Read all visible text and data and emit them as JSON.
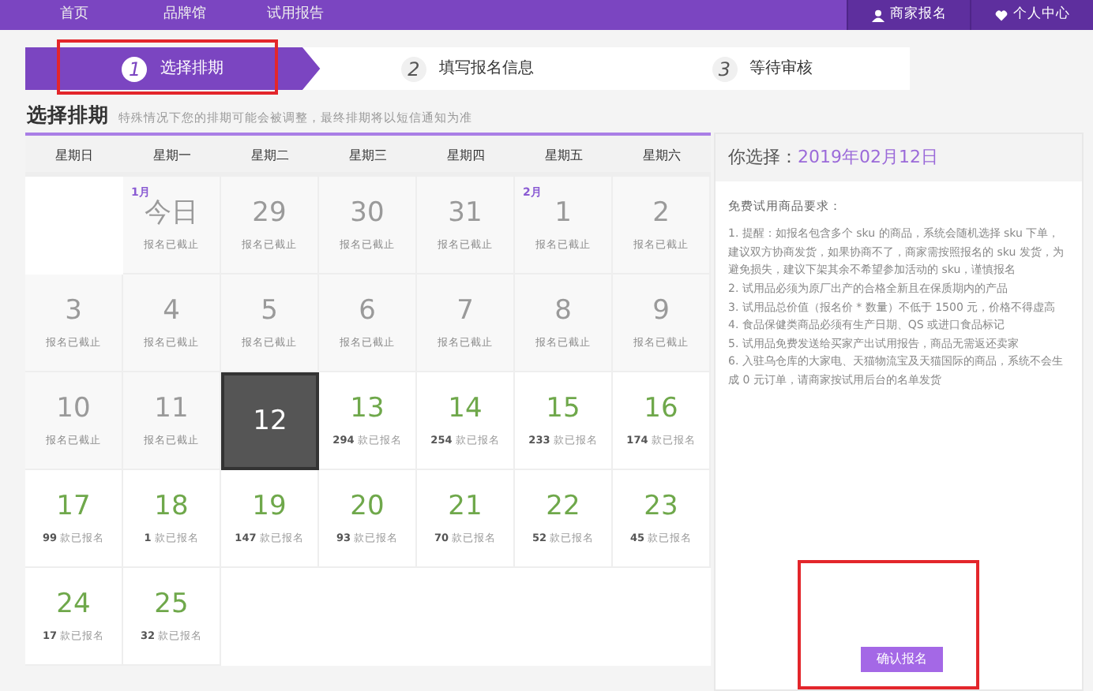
{
  "nav": {
    "links": [
      "首页",
      "品牌馆",
      "试用报告"
    ],
    "right": [
      {
        "label": "商家报名"
      },
      {
        "label": "个人中心"
      }
    ]
  },
  "steps": [
    {
      "number": "1",
      "label": "选择排期",
      "selected": true,
      "highlighted": true
    },
    {
      "number": "2",
      "label": "填写报名信息",
      "selected": false,
      "highlighted": false
    },
    {
      "number": "3",
      "label": "等待审核",
      "selected": false,
      "highlighted": false
    }
  ],
  "section": {
    "title": "选择排期",
    "subtitle": "特殊情况下您的排期可能会被调整，最终排期将以短信通知为准"
  },
  "calendar": {
    "weekdays": [
      "星期日",
      "星期一",
      "星期二",
      "星期三",
      "星期四",
      "星期五",
      "星期六"
    ],
    "weeks": [
      [
        {
          "kind": "empty"
        },
        {
          "kind": "past",
          "month": "1月",
          "day": "今日",
          "note": "报名已截止"
        },
        {
          "kind": "past",
          "day": "29",
          "note": "报名已截止"
        },
        {
          "kind": "past",
          "day": "30",
          "note": "报名已截止"
        },
        {
          "kind": "past",
          "day": "31",
          "note": "报名已截止"
        },
        {
          "kind": "past",
          "month": "2月",
          "day": "1",
          "note": "报名已截止"
        },
        {
          "kind": "past",
          "day": "2",
          "note": "报名已截止"
        }
      ],
      [
        {
          "kind": "past",
          "day": "3",
          "note": "报名已截止"
        },
        {
          "kind": "past",
          "day": "4",
          "note": "报名已截止"
        },
        {
          "kind": "past",
          "day": "5",
          "note": "报名已截止"
        },
        {
          "kind": "past",
          "day": "6",
          "note": "报名已截止"
        },
        {
          "kind": "past",
          "day": "7",
          "note": "报名已截止"
        },
        {
          "kind": "past",
          "day": "8",
          "note": "报名已截止"
        },
        {
          "kind": "past",
          "day": "9",
          "note": "报名已截止"
        }
      ],
      [
        {
          "kind": "past",
          "day": "10",
          "note": "报名已截止"
        },
        {
          "kind": "past",
          "day": "11",
          "note": "报名已截止"
        },
        {
          "kind": "open",
          "day": "12",
          "selected": true
        },
        {
          "kind": "open",
          "day": "13",
          "count": "294",
          "note": "款已报名",
          "selected": false
        },
        {
          "kind": "open",
          "day": "14",
          "count": "254",
          "note": "款已报名",
          "selected": false
        },
        {
          "kind": "open",
          "day": "15",
          "count": "233",
          "note": "款已报名",
          "selected": false
        },
        {
          "kind": "open",
          "day": "16",
          "count": "174",
          "note": "款已报名",
          "selected": false
        }
      ],
      [
        {
          "kind": "open",
          "day": "17",
          "count": "99",
          "note": "款已报名",
          "selected": false
        },
        {
          "kind": "open",
          "day": "18",
          "count": "1",
          "note": "款已报名",
          "selected": false
        },
        {
          "kind": "open",
          "day": "19",
          "count": "147",
          "note": "款已报名",
          "selected": false
        },
        {
          "kind": "open",
          "day": "20",
          "count": "93",
          "note": "款已报名",
          "selected": false
        },
        {
          "kind": "open",
          "day": "21",
          "count": "70",
          "note": "款已报名",
          "selected": false
        },
        {
          "kind": "open",
          "day": "22",
          "count": "52",
          "note": "款已报名",
          "selected": false
        },
        {
          "kind": "open",
          "day": "23",
          "count": "45",
          "note": "款已报名",
          "selected": false
        }
      ],
      [
        {
          "kind": "open",
          "day": "24",
          "count": "17",
          "note": "款已报名",
          "selected": false
        },
        {
          "kind": "open",
          "day": "25",
          "count": "32",
          "note": "款已报名",
          "selected": false
        },
        {
          "kind": "empty"
        },
        {
          "kind": "empty"
        },
        {
          "kind": "empty"
        },
        {
          "kind": "empty"
        },
        {
          "kind": "empty"
        }
      ]
    ]
  },
  "summary": {
    "label": "你选择：",
    "date": "2019年02月12日",
    "requirements_title": "免费试用商品要求：",
    "requirements": [
      "1. 提醒：如报名包含多个 sku 的商品，系统会随机选择 sku 下单，建议双方协商发货，如果协商不了，商家需按照报名的 sku 发货，为避免损失，建议下架其余不希望参加活动的 sku，谨慎报名",
      "2. 试用品必须为原厂出产的合格全新且在保质期内的产品",
      "3. 试用品总价值（报名价 * 数量）不低于 1500 元，价格不得虚高",
      "4. 食品保健类商品必须有生产日期、QS 或进口食品标记",
      "5. 试用品免费发送给买家产出试用报告，商品无需返还卖家",
      "6. 入驻乌仓库的大家电、天猫物流宝及天猫国际的商品，系统不会生成 0 元订单，请商家按试用后台的名单发货"
    ],
    "button": {
      "label": "确认报名",
      "highlighted": true
    }
  }
}
